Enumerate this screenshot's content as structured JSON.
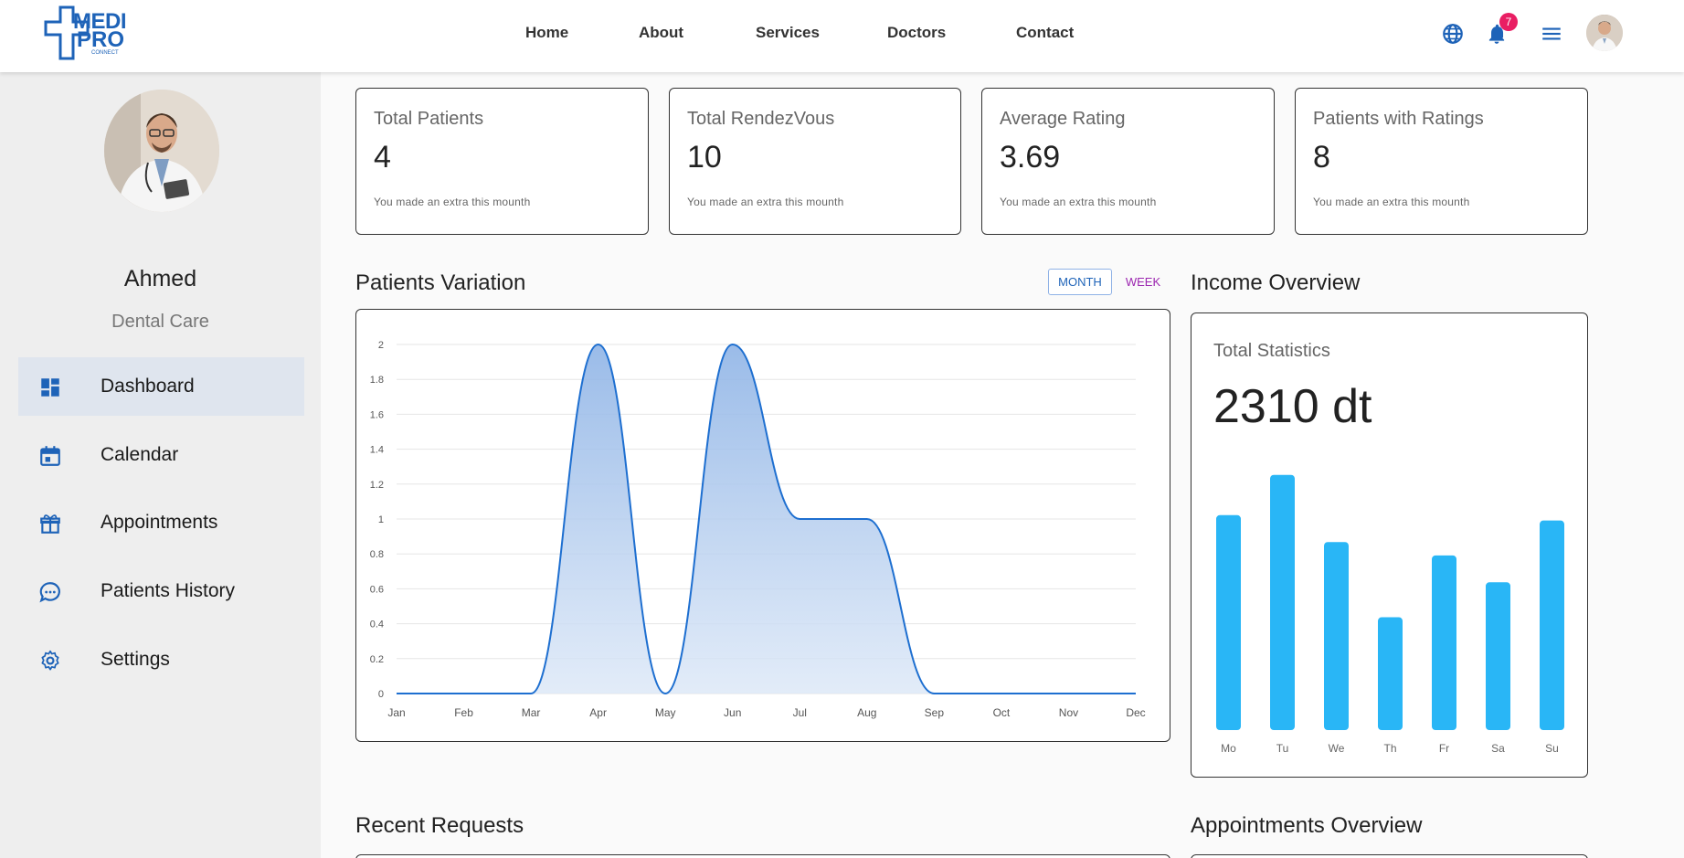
{
  "brand": {
    "line1": "MEDI",
    "line2": "PRO",
    "line3": "CONNECT"
  },
  "nav": [
    {
      "label": "Home"
    },
    {
      "label": "About"
    },
    {
      "label": "Services"
    },
    {
      "label": "Doctors"
    },
    {
      "label": "Contact"
    }
  ],
  "header": {
    "notification_count": "7"
  },
  "profile": {
    "name": "Ahmed",
    "specialty": "Dental Care"
  },
  "sidebar": {
    "items": [
      {
        "label": "Dashboard",
        "icon": "dashboard-icon",
        "active": true
      },
      {
        "label": "Calendar",
        "icon": "calendar-icon"
      },
      {
        "label": "Appointments",
        "icon": "gift-icon"
      },
      {
        "label": "Patients History",
        "icon": "chat-icon"
      },
      {
        "label": "Settings",
        "icon": "gear-icon"
      }
    ]
  },
  "stats": [
    {
      "title": "Total Patients",
      "value": "4",
      "note": "You made an extra this mounth"
    },
    {
      "title": "Total RendezVous",
      "value": "10",
      "note": "You made an extra this mounth"
    },
    {
      "title": "Average Rating",
      "value": "3.69",
      "note": "You made an extra this mounth"
    },
    {
      "title": "Patients with Ratings",
      "value": "8",
      "note": "You made an extra this mounth"
    }
  ],
  "patients_variation": {
    "title": "Patients Variation",
    "toggle": {
      "month": "MONTH",
      "week": "WEEK",
      "selected": "MONTH"
    }
  },
  "income": {
    "title": "Income Overview",
    "label": "Total Statistics",
    "value": "2310 dt"
  },
  "sections": {
    "recent_requests": "Recent Requests",
    "appointments_overview": "Appointments Overview"
  },
  "chart_data": [
    {
      "type": "area",
      "x": [
        "Jan",
        "Feb",
        "Mar",
        "Apr",
        "May",
        "Jun",
        "Jul",
        "Aug",
        "Sep",
        "Oct",
        "Nov",
        "Dec"
      ],
      "values": [
        0,
        0,
        0,
        2,
        0,
        2,
        1,
        1,
        0,
        0,
        0,
        0
      ],
      "ylim": [
        0,
        2
      ],
      "yticks": [
        "0",
        "0.2",
        "0.4",
        "0.6",
        "0.8",
        "1",
        "1.2",
        "1.4",
        "1.6",
        "1.8",
        "2"
      ],
      "grid": true,
      "color": "#1e6fd0"
    },
    {
      "type": "bar",
      "categories": [
        "Mo",
        "Tu",
        "We",
        "Th",
        "Fr",
        "Sa",
        "Su"
      ],
      "values": [
        80,
        95,
        70,
        42,
        65,
        55,
        78
      ],
      "color": "#29b6f6"
    }
  ]
}
